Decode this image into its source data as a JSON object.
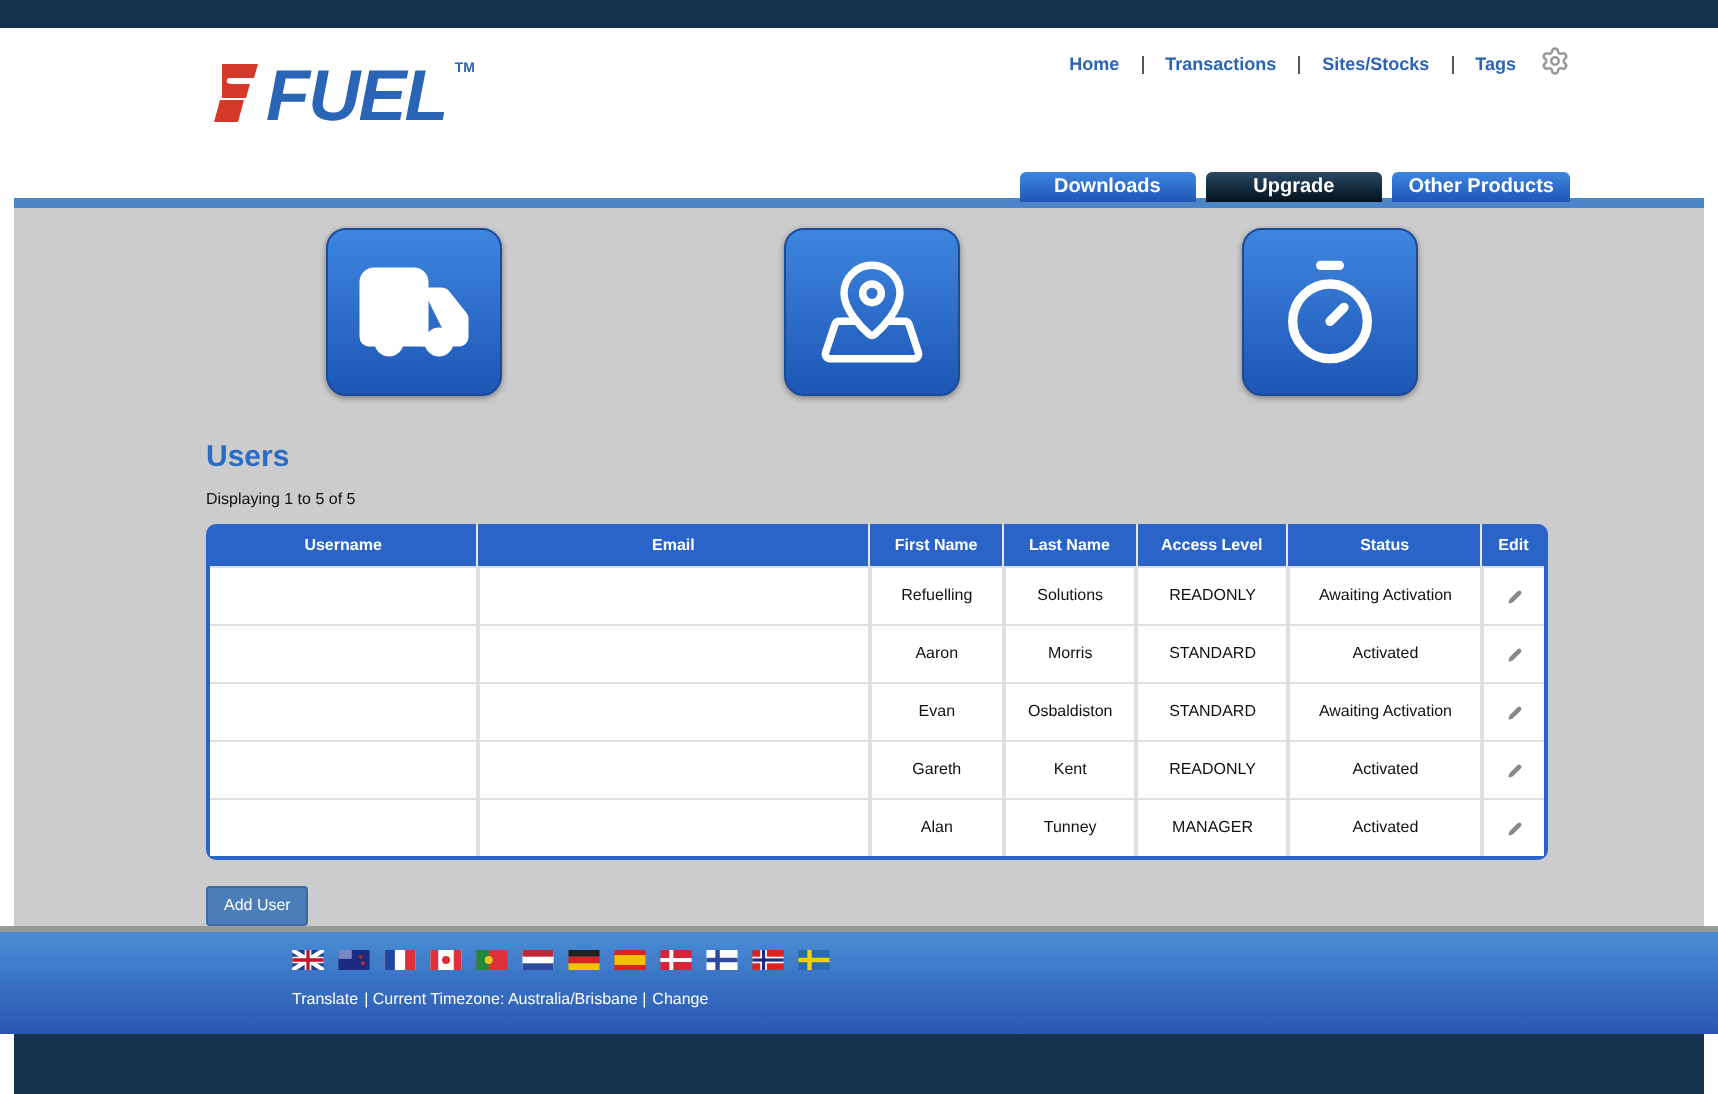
{
  "header": {
    "logo": {
      "text": "FUEL",
      "trademark": "TM"
    },
    "nav": [
      {
        "label": "Home"
      },
      {
        "label": "Transactions"
      },
      {
        "label": "Sites/Stocks"
      },
      {
        "label": "Tags"
      }
    ],
    "tabs": [
      {
        "label": "Downloads",
        "selected": false
      },
      {
        "label": "Upgrade",
        "selected": true
      },
      {
        "label": "Other Products",
        "selected": false
      }
    ]
  },
  "features": [
    {
      "kind": "truck"
    },
    {
      "kind": "map"
    },
    {
      "kind": "stopwatch"
    }
  ],
  "users": {
    "title": "Users",
    "summary": "Displaying 1 to 5 of 5",
    "table": {
      "columns": [
        "Username",
        "Email",
        "First Name",
        "Last Name",
        "Access Level",
        "Status",
        "Edit"
      ],
      "rows": [
        {
          "first_name": "Refuelling",
          "last_name": "Solutions",
          "access_level": "READONLY",
          "status": "Awaiting Activation"
        },
        {
          "first_name": "Aaron",
          "last_name": "Morris",
          "access_level": "STANDARD",
          "status": "Activated"
        },
        {
          "first_name": "Evan",
          "last_name": "Osbaldiston",
          "access_level": "STANDARD",
          "status": "Awaiting Activation"
        },
        {
          "first_name": "Gareth",
          "last_name": "Kent",
          "access_level": "READONLY",
          "status": "Activated"
        },
        {
          "first_name": "Alan",
          "last_name": "Tunney",
          "access_level": "MANAGER",
          "status": "Activated"
        }
      ]
    },
    "add_button": "Add User"
  },
  "footer": {
    "flags": [
      {
        "kind": "uk"
      },
      {
        "kind": "nz"
      },
      {
        "kind": "fr"
      },
      {
        "kind": "ca"
      },
      {
        "kind": "pt"
      },
      {
        "kind": "nl"
      },
      {
        "kind": "de"
      },
      {
        "kind": "es"
      },
      {
        "kind": "dk"
      },
      {
        "kind": "fi"
      },
      {
        "kind": "no"
      },
      {
        "kind": "se"
      }
    ],
    "translate_link": "Translate",
    "timezone": "| Current Timezone: Australia/Brisbane |",
    "change_link": "Change"
  }
}
